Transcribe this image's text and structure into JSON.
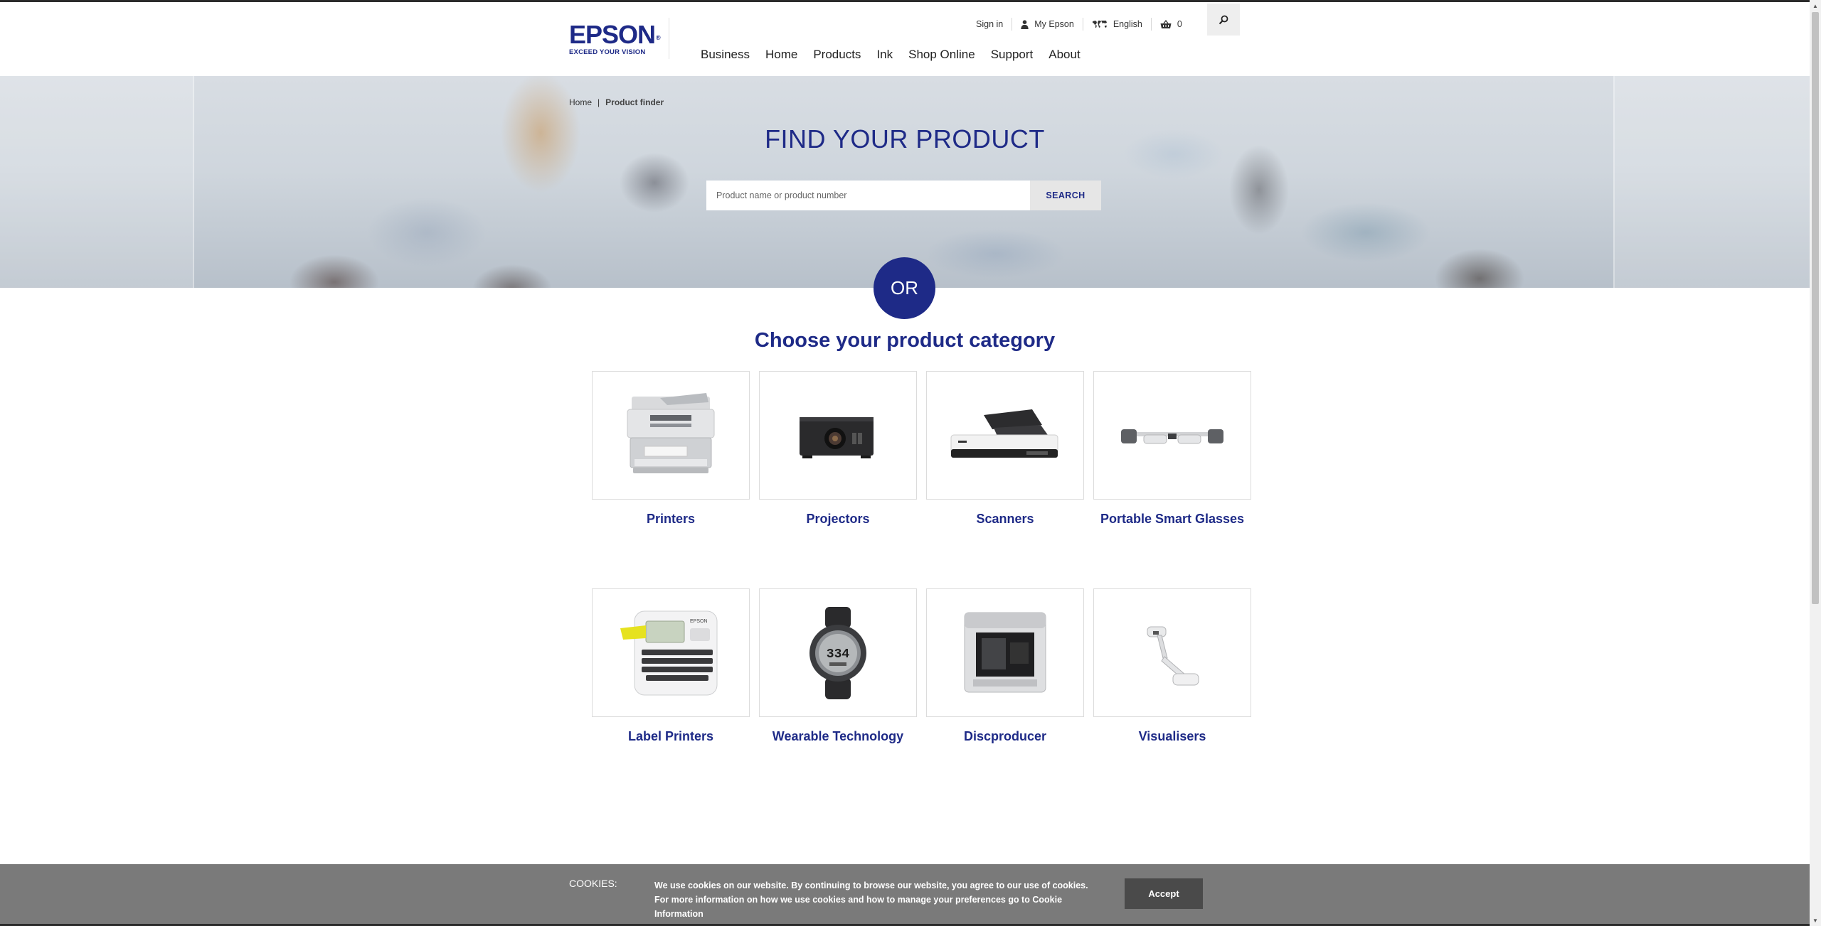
{
  "brand": {
    "name": "EPSON",
    "tagline": "EXCEED YOUR VISION",
    "color": "#1e2a87"
  },
  "utility": {
    "sign_in": "Sign in",
    "my_epson": "My Epson",
    "language": "English",
    "cart_count": "0"
  },
  "nav": {
    "items": [
      {
        "label": "Business"
      },
      {
        "label": "Home"
      },
      {
        "label": "Products"
      },
      {
        "label": "Ink"
      },
      {
        "label": "Shop Online"
      },
      {
        "label": "Support"
      },
      {
        "label": "About"
      }
    ]
  },
  "breadcrumb": {
    "home": "Home",
    "separator": "|",
    "current": "Product finder"
  },
  "hero": {
    "title": "FIND YOUR PRODUCT",
    "search_placeholder": "Product name or product number",
    "search_button": "SEARCH"
  },
  "or_label": "OR",
  "categories": {
    "heading": "Choose your product category",
    "items": [
      {
        "label": "Printers",
        "icon": "printer-image"
      },
      {
        "label": "Projectors",
        "icon": "projector-image"
      },
      {
        "label": "Scanners",
        "icon": "scanner-image"
      },
      {
        "label": "Portable Smart Glasses",
        "icon": "smart-glasses-image"
      },
      {
        "label": "Label Printers",
        "icon": "label-printer-image"
      },
      {
        "label": "Wearable Technology",
        "icon": "watch-image"
      },
      {
        "label": "Discproducer",
        "icon": "discproducer-image"
      },
      {
        "label": "Visualisers",
        "icon": "visualiser-image"
      }
    ]
  },
  "cookies": {
    "label": "COOKIES:",
    "text": "We use cookies on our website. By continuing to browse our website, you agree to our use of cookies. For more information on how we use cookies and how to manage your preferences go to",
    "link": "Cookie Information",
    "accept": "Accept"
  },
  "product_screen_text": {
    "watch_display": "334",
    "device_brand": "EPSON"
  }
}
